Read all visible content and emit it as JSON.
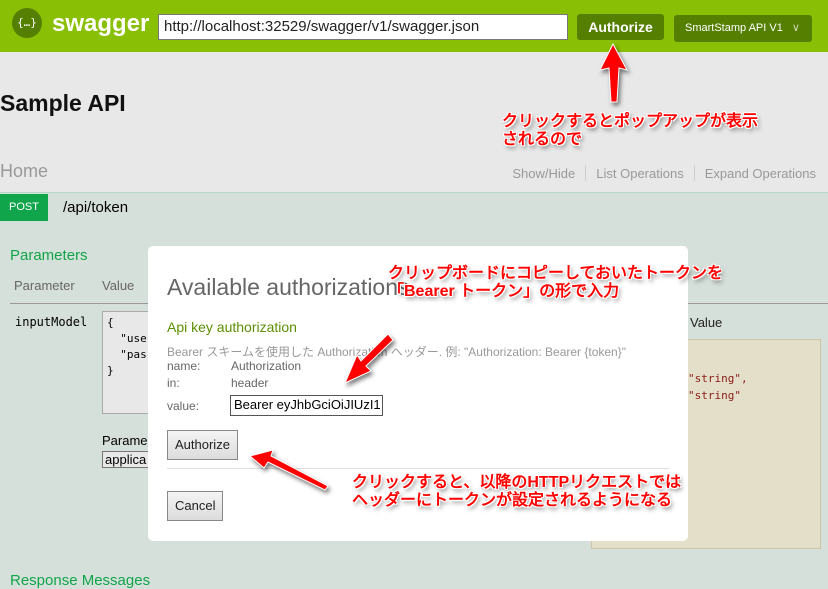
{
  "header": {
    "logo_icon": "{…}",
    "logo_text": "swagger",
    "url": "http://localhost:32529/swagger/v1/swagger.json",
    "authorize": "Authorize",
    "api_select": "SmartStamp API V1",
    "chevron": "∨"
  },
  "page": {
    "title": "Sample API",
    "section": "Home",
    "links": [
      "Show/Hide",
      "List Operations",
      "Expand Operations"
    ]
  },
  "operation": {
    "method": "POST",
    "path": "/api/token",
    "parameters_title": "Parameters",
    "col_parameter": "Parameter",
    "col_value": "Value",
    "param_name": "inputModel",
    "param_value": "{\n  \"use\n  \"pas\n}",
    "content_type_label": "Parame",
    "content_type": "applica",
    "model_value_label": "Value",
    "example_line1": "\"string\",",
    "example_line2": "\"string\"",
    "response_title": "Response Messages"
  },
  "modal": {
    "title": "Available authorizations",
    "subtitle": "Api key authorization",
    "description": "Bearer スキームを使用した Authorization ヘッダー. 例: \"Authorization: Bearer {token}\"",
    "name_label": "name:",
    "name_value": "Authorization",
    "in_label": "in:",
    "in_value": "header",
    "value_label": "value:",
    "value": "Bearer eyJhbGciOiJIUzI1",
    "authorize": "Authorize",
    "cancel": "Cancel"
  },
  "annotations": {
    "note1_l1": "クリックするとポップアップが表示",
    "note1_l2": "されるので",
    "note2_l1": "クリップボードにコピーしておいたトークンを",
    "note2_l2": "「Bearer トークン」の形で入力",
    "note3_l1": "クリックすると、以降のHTTPリクエストでは",
    "note3_l2": "ヘッダーにトークンが設定されるようになる",
    "color": "#ff0000"
  },
  "colors": {
    "topbar": "#89bf04",
    "post": "#10a54a"
  }
}
